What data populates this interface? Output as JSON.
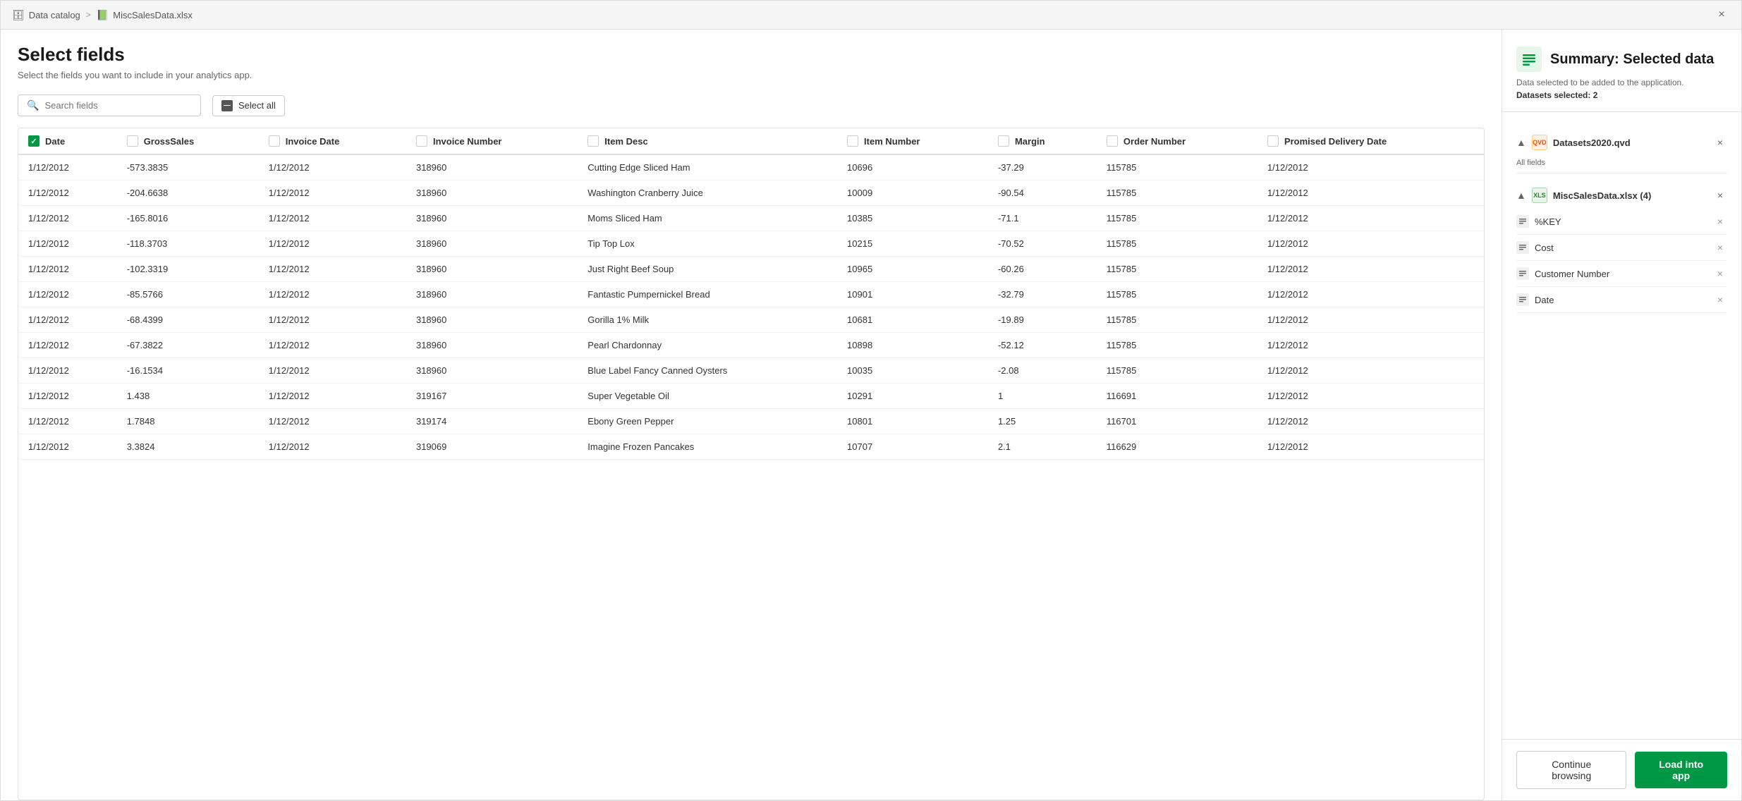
{
  "window": {
    "title": "MiscSalesData.xlsx",
    "close_label": "×"
  },
  "breadcrumb": {
    "data_catalog": "Data catalog",
    "separator": ">",
    "file": "MiscSalesData.xlsx"
  },
  "page": {
    "title": "Select fields",
    "subtitle": "Select the fields you want to include in your analytics app."
  },
  "toolbar": {
    "search_placeholder": "Search fields",
    "select_all_label": "Select all"
  },
  "table": {
    "columns": [
      {
        "id": "date",
        "label": "Date",
        "checked": true
      },
      {
        "id": "grosssales",
        "label": "GrossSales",
        "checked": false
      },
      {
        "id": "invoicedate",
        "label": "Invoice Date",
        "checked": false
      },
      {
        "id": "invoicenumber",
        "label": "Invoice Number",
        "checked": false
      },
      {
        "id": "itemdesc",
        "label": "Item Desc",
        "checked": false
      },
      {
        "id": "itemnumber",
        "label": "Item Number",
        "checked": false
      },
      {
        "id": "margin",
        "label": "Margin",
        "checked": false
      },
      {
        "id": "ordernumber",
        "label": "Order Number",
        "checked": false
      },
      {
        "id": "promiseddeliverydate",
        "label": "Promised Delivery Date",
        "checked": false
      }
    ],
    "rows": [
      {
        "date": "1/12/2012",
        "grosssales": "-573.3835",
        "invoicedate": "1/12/2012",
        "invoicenumber": "318960",
        "itemdesc": "Cutting Edge Sliced Ham",
        "itemnumber": "10696",
        "margin": "-37.29",
        "ordernumber": "115785",
        "promiseddeliverydate": "1/12/2012"
      },
      {
        "date": "1/12/2012",
        "grosssales": "-204.6638",
        "invoicedate": "1/12/2012",
        "invoicenumber": "318960",
        "itemdesc": "Washington Cranberry Juice",
        "itemnumber": "10009",
        "margin": "-90.54",
        "ordernumber": "115785",
        "promiseddeliverydate": "1/12/2012"
      },
      {
        "date": "1/12/2012",
        "grosssales": "-165.8016",
        "invoicedate": "1/12/2012",
        "invoicenumber": "318960",
        "itemdesc": "Moms Sliced Ham",
        "itemnumber": "10385",
        "margin": "-71.1",
        "ordernumber": "115785",
        "promiseddeliverydate": "1/12/2012"
      },
      {
        "date": "1/12/2012",
        "grosssales": "-118.3703",
        "invoicedate": "1/12/2012",
        "invoicenumber": "318960",
        "itemdesc": "Tip Top Lox",
        "itemnumber": "10215",
        "margin": "-70.52",
        "ordernumber": "115785",
        "promiseddeliverydate": "1/12/2012"
      },
      {
        "date": "1/12/2012",
        "grosssales": "-102.3319",
        "invoicedate": "1/12/2012",
        "invoicenumber": "318960",
        "itemdesc": "Just Right Beef Soup",
        "itemnumber": "10965",
        "margin": "-60.26",
        "ordernumber": "115785",
        "promiseddeliverydate": "1/12/2012"
      },
      {
        "date": "1/12/2012",
        "grosssales": "-85.5766",
        "invoicedate": "1/12/2012",
        "invoicenumber": "318960",
        "itemdesc": "Fantastic Pumpernickel Bread",
        "itemnumber": "10901",
        "margin": "-32.79",
        "ordernumber": "115785",
        "promiseddeliverydate": "1/12/2012"
      },
      {
        "date": "1/12/2012",
        "grosssales": "-68.4399",
        "invoicedate": "1/12/2012",
        "invoicenumber": "318960",
        "itemdesc": "Gorilla 1% Milk",
        "itemnumber": "10681",
        "margin": "-19.89",
        "ordernumber": "115785",
        "promiseddeliverydate": "1/12/2012"
      },
      {
        "date": "1/12/2012",
        "grosssales": "-67.3822",
        "invoicedate": "1/12/2012",
        "invoicenumber": "318960",
        "itemdesc": "Pearl Chardonnay",
        "itemnumber": "10898",
        "margin": "-52.12",
        "ordernumber": "115785",
        "promiseddeliverydate": "1/12/2012"
      },
      {
        "date": "1/12/2012",
        "grosssales": "-16.1534",
        "invoicedate": "1/12/2012",
        "invoicenumber": "318960",
        "itemdesc": "Blue Label Fancy Canned Oysters",
        "itemnumber": "10035",
        "margin": "-2.08",
        "ordernumber": "115785",
        "promiseddeliverydate": "1/12/2012"
      },
      {
        "date": "1/12/2012",
        "grosssales": "1.438",
        "invoicedate": "1/12/2012",
        "invoicenumber": "319167",
        "itemdesc": "Super Vegetable Oil",
        "itemnumber": "10291",
        "margin": "1",
        "ordernumber": "116691",
        "promiseddeliverydate": "1/12/2012"
      },
      {
        "date": "1/12/2012",
        "grosssales": "1.7848",
        "invoicedate": "1/12/2012",
        "invoicenumber": "319174",
        "itemdesc": "Ebony Green Pepper",
        "itemnumber": "10801",
        "margin": "1.25",
        "ordernumber": "116701",
        "promiseddeliverydate": "1/12/2012"
      },
      {
        "date": "1/12/2012",
        "grosssales": "3.3824",
        "invoicedate": "1/12/2012",
        "invoicenumber": "319069",
        "itemdesc": "Imagine Frozen Pancakes",
        "itemnumber": "10707",
        "margin": "2.1",
        "ordernumber": "116629",
        "promiseddeliverydate": "1/12/2012"
      }
    ]
  },
  "summary": {
    "title": "Summary: Selected data",
    "subtitle": "Data selected to be added to the application.",
    "datasets_label": "Datasets selected: 2",
    "icon": "📊"
  },
  "datasets": {
    "datasets2020": {
      "name": "Datasets2020.qvd",
      "fields_label": "All fields",
      "type": "qvd"
    },
    "miscsales": {
      "name": "MiscSalesData.xlsx (4)",
      "type": "xlsx",
      "fields": [
        {
          "name": "%KEY"
        },
        {
          "name": "Cost"
        },
        {
          "name": "Customer Number"
        },
        {
          "name": "Date"
        }
      ]
    }
  },
  "footer": {
    "continue_browsing": "Continue browsing",
    "load_into_app": "Load into app"
  }
}
